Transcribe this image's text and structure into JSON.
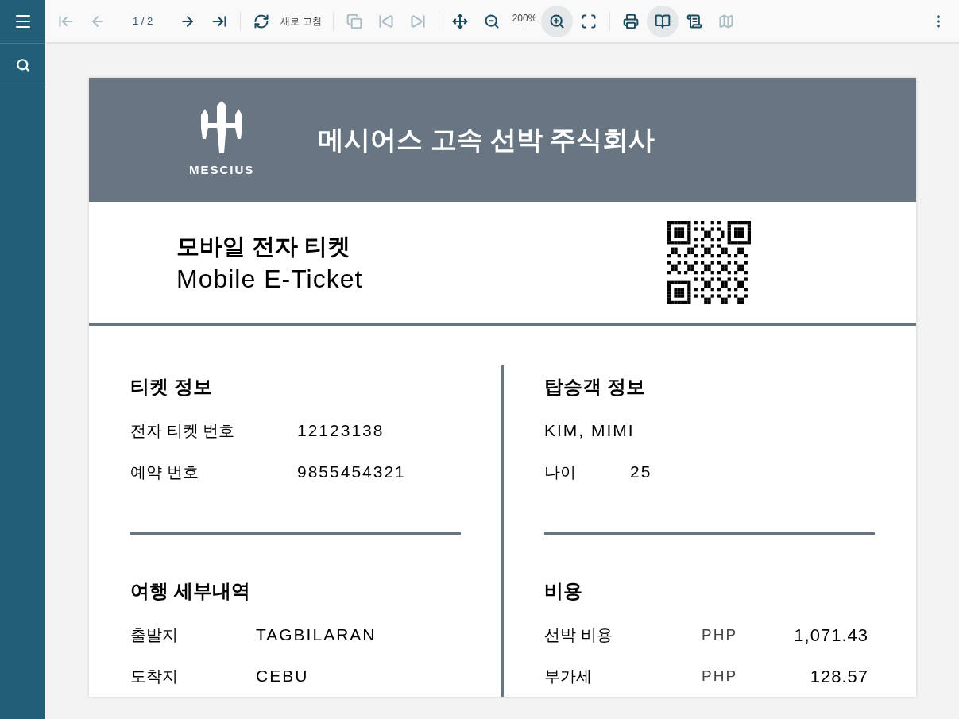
{
  "sidebar": {
    "items": [
      {
        "kind": "menu"
      },
      {
        "kind": "search"
      }
    ]
  },
  "toolbar": {
    "items": [
      {
        "kind": "icon",
        "disabled": true
      },
      {
        "kind": "icon",
        "disabled": true
      },
      {
        "kind": "page",
        "text": "1 / 2"
      },
      {
        "kind": "icon",
        "disabled": false
      },
      {
        "kind": "icon",
        "disabled": false
      },
      {
        "kind": "separator"
      },
      {
        "kind": "icon",
        "disabled": false
      },
      {
        "kind": "label",
        "text": "새로 고침"
      },
      {
        "kind": "separator"
      },
      {
        "kind": "icon",
        "disabled": true
      },
      {
        "kind": "icon",
        "disabled": true
      },
      {
        "kind": "icon",
        "disabled": true
      },
      {
        "kind": "separator"
      },
      {
        "kind": "icon",
        "disabled": false
      },
      {
        "kind": "icon",
        "disabled": false
      },
      {
        "kind": "zoom",
        "text": "200%",
        "sub": "..."
      },
      {
        "kind": "icon",
        "disabled": false,
        "selected": true
      },
      {
        "kind": "icon",
        "disabled": false
      },
      {
        "kind": "separator"
      },
      {
        "kind": "icon",
        "disabled": false
      },
      {
        "kind": "icon",
        "disabled": false,
        "selected": true
      },
      {
        "kind": "icon",
        "disabled": false
      },
      {
        "kind": "icon",
        "disabled": true
      },
      {
        "kind": "spacer"
      },
      {
        "kind": "icon",
        "disabled": false
      }
    ]
  },
  "ticket": {
    "logo_text": "MESCIUS",
    "company": "메시어스 고속 선박 주식회사",
    "title_ko": "모바일 전자 티켓",
    "title_en": "Mobile E-Ticket",
    "ticket_info": {
      "title": "티켓 정보",
      "rows": [
        {
          "label": "전자 티켓 번호",
          "value": "12123138"
        },
        {
          "label": "예약 번호",
          "value": "9855454321"
        }
      ]
    },
    "passenger": {
      "title": "탑승객 정보",
      "name": "KIM, MIMI",
      "rows": [
        {
          "label": "나이",
          "value": "25"
        }
      ]
    },
    "trip": {
      "title": "여행 세부내역",
      "rows": [
        {
          "label": "출발지",
          "value": "TAGBILARAN"
        },
        {
          "label": "도착지",
          "value": "CEBU"
        }
      ]
    },
    "costs": {
      "title": "비용",
      "rows": [
        {
          "label": "선박 비용",
          "currency": "PHP",
          "amount": "1,071.43"
        },
        {
          "label": "부가세",
          "currency": "PHP",
          "amount": "128.57"
        }
      ]
    }
  }
}
